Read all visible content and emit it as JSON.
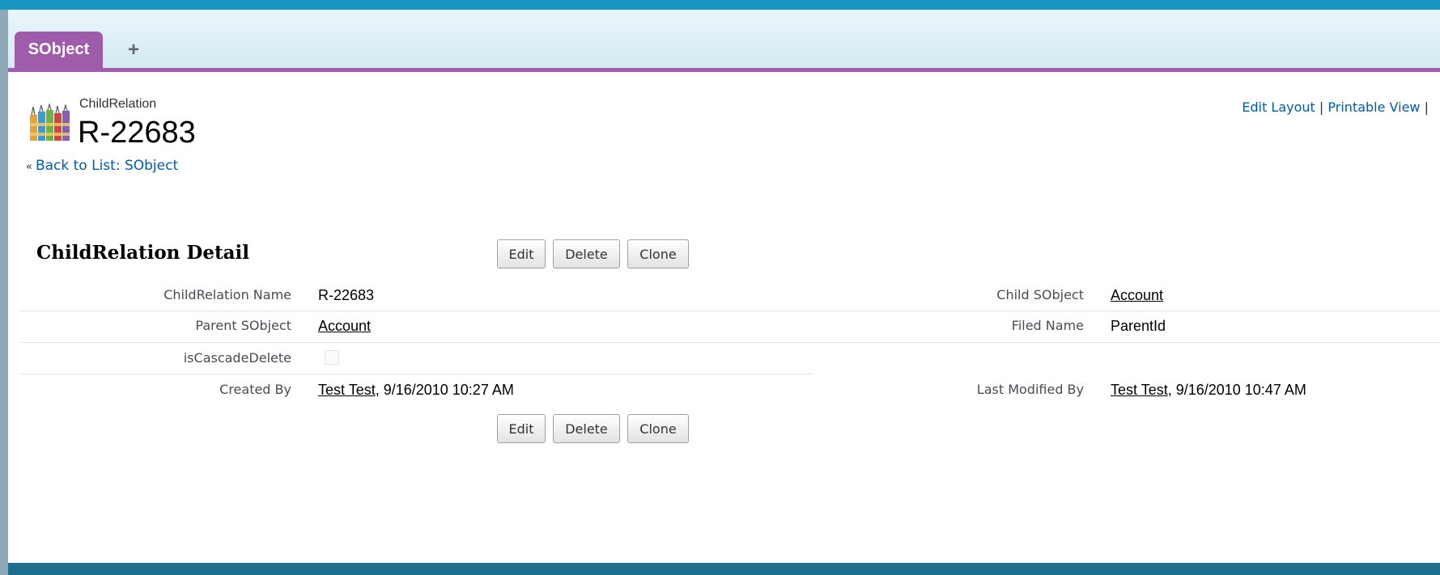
{
  "tabs": {
    "active_label": "SObject",
    "add_symbol": "+"
  },
  "header": {
    "object_label": "ChildRelation",
    "record_name": "R-22683",
    "back_chevron": "«",
    "back_link": "Back to List: SObject",
    "edit_layout": "Edit Layout",
    "separator": "|",
    "printable_view": "Printable View"
  },
  "detail": {
    "title": "ChildRelation Detail",
    "buttons": {
      "edit": "Edit",
      "delete": "Delete",
      "clone": "Clone"
    },
    "fields": {
      "childrelation_name_label": "ChildRelation Name",
      "childrelation_name_value": "R-22683",
      "child_sobject_label": "Child SObject",
      "child_sobject_value": "Account",
      "parent_sobject_label": "Parent SObject",
      "parent_sobject_value": "Account",
      "filed_name_label": "Filed Name",
      "filed_name_value": "ParentId",
      "iscascadedelete_label": "isCascadeDelete",
      "iscascadedelete_checked": false,
      "created_by_label": "Created By",
      "created_by_user": "Test Test",
      "created_by_date": ", 9/16/2010 10:27 AM",
      "last_modified_by_label": "Last Modified By",
      "last_modified_by_user": "Test Test",
      "last_modified_by_date": ", 9/16/2010 10:47 AM"
    }
  },
  "colors": {
    "tab_accent": "#9e5cab",
    "link": "#015ba7",
    "top_strip": "#1797c0",
    "bottom_bar": "#1c6e8c"
  }
}
